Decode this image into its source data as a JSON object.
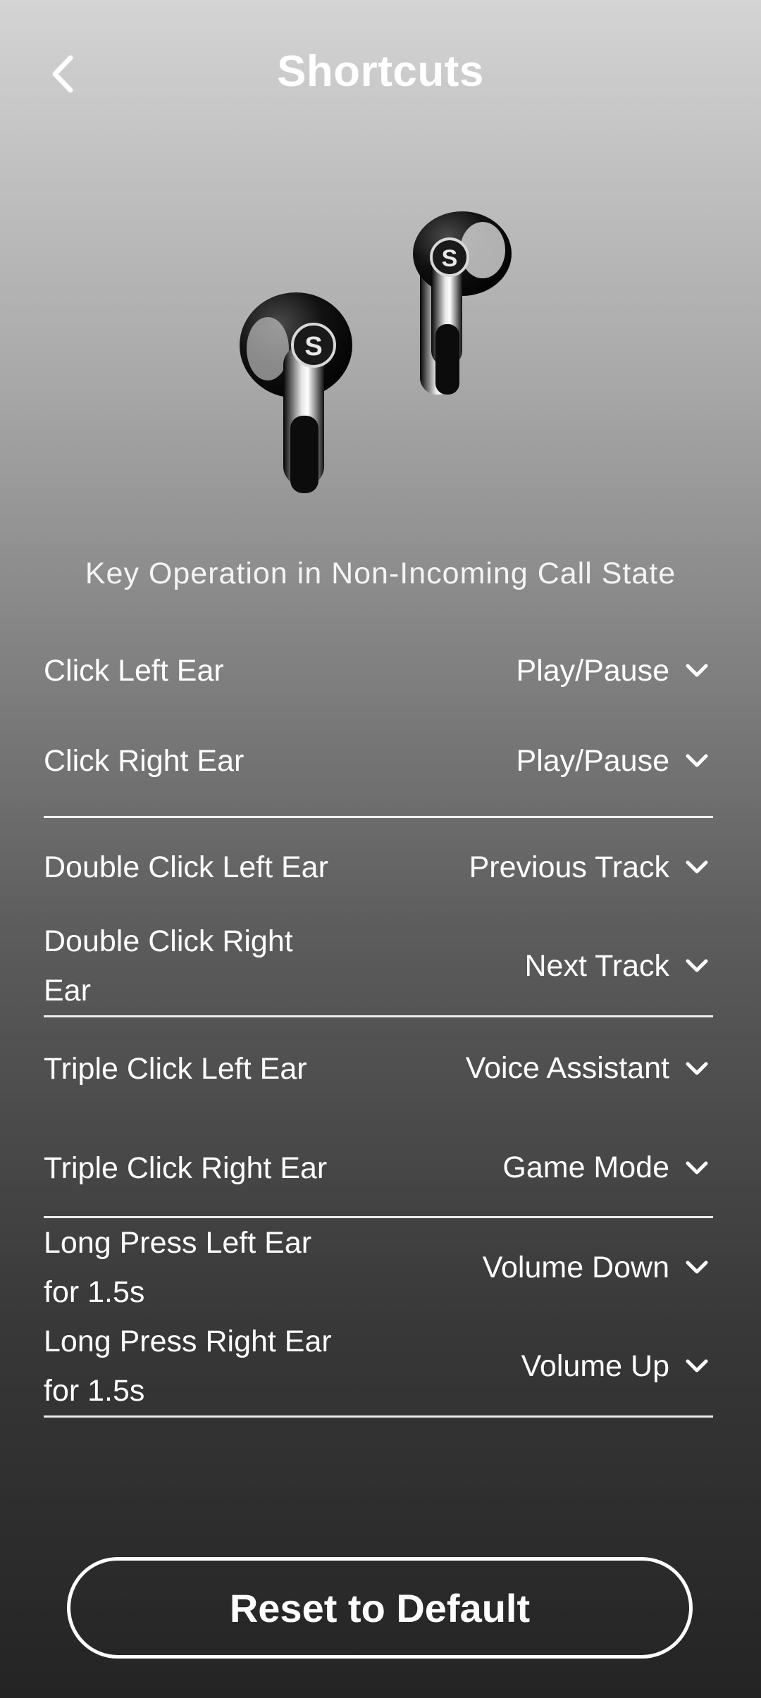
{
  "header": {
    "title": "Shortcuts",
    "back_icon": "chevron-left-icon"
  },
  "section": {
    "title": "Key Operation in Non-Incoming Call State"
  },
  "shortcuts": [
    {
      "label": "Click Left Ear",
      "value": "Play/Pause"
    },
    {
      "label": "Click Right Ear",
      "value": "Play/Pause"
    },
    {
      "label": "Double Click Left Ear",
      "value": "Previous Track"
    },
    {
      "label": "Double Click Right Ear",
      "value": "Next Track"
    },
    {
      "label": "Triple Click Left Ear",
      "value": "Voice Assistant"
    },
    {
      "label": "Triple Click Right Ear",
      "value": "Game Mode"
    },
    {
      "label": "Long Press Left Ear for 1.5s",
      "value": "Volume Down"
    },
    {
      "label": "Long Press Right Ear for 1.5s",
      "value": "Volume Up"
    }
  ],
  "reset": {
    "label": "Reset to Default"
  },
  "colors": {
    "text": "#ffffff",
    "background_top": "#d4d4d4",
    "background_bottom": "#242424"
  }
}
